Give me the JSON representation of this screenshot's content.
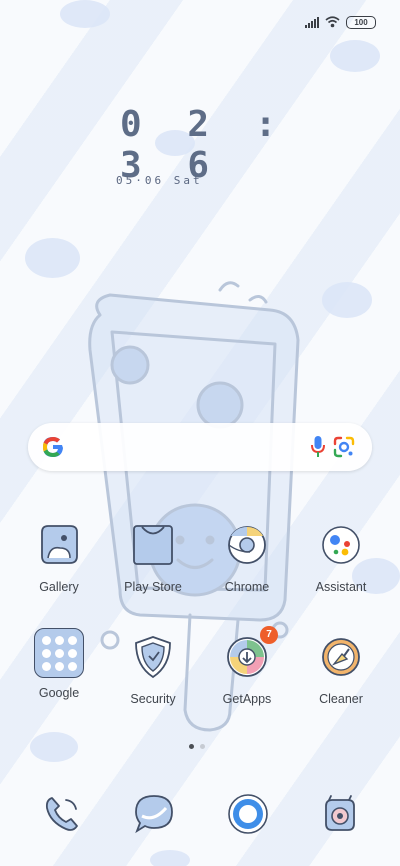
{
  "status_bar": {
    "battery": "100",
    "signal_icon": "signal-icon",
    "wifi_icon": "wifi-icon"
  },
  "clock": {
    "time": "0 2 : 3 6",
    "date": "05·06 Sat"
  },
  "search_bar": {
    "logo": "google-g-icon",
    "mic_icon": "mic-icon",
    "lens_icon": "lens-icon"
  },
  "apps": [
    {
      "label": "Gallery",
      "icon": "gallery-icon"
    },
    {
      "label": "Play Store",
      "icon": "play-store-icon"
    },
    {
      "label": "Chrome",
      "icon": "chrome-icon"
    },
    {
      "label": "Assistant",
      "icon": "assistant-icon"
    },
    {
      "label": "Google",
      "icon": "google-folder-icon"
    },
    {
      "label": "Security",
      "icon": "security-icon"
    },
    {
      "label": "GetApps",
      "icon": "getapps-icon",
      "badge": "7"
    },
    {
      "label": "Cleaner",
      "icon": "cleaner-icon"
    }
  ],
  "page_indicator": {
    "pages": 2,
    "current": 1
  },
  "dock": [
    {
      "icon": "phone-icon"
    },
    {
      "icon": "messages-icon"
    },
    {
      "icon": "browser-icon"
    },
    {
      "icon": "camera-icon"
    }
  ],
  "colors": {
    "accent": "#5e6d87",
    "icon_fill": "#b4cbeb",
    "badge": "#ee5e2a"
  }
}
